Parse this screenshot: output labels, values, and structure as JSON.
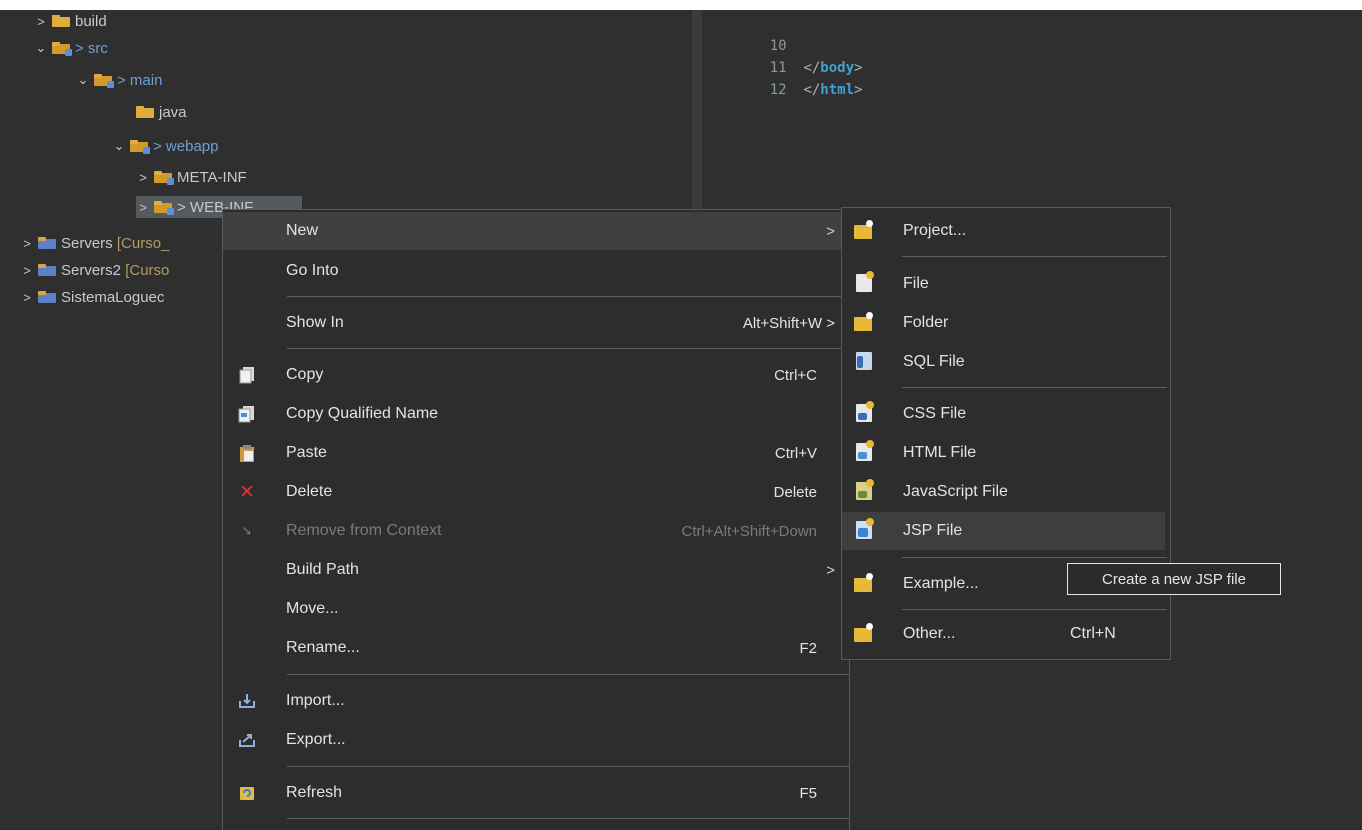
{
  "tree": {
    "items": [
      {
        "chevron": ">",
        "label": "build"
      },
      {
        "chevron": "⌄",
        "label": "> src"
      },
      {
        "chevron": "⌄",
        "label": "> main"
      },
      {
        "chevron": "",
        "label": "java"
      },
      {
        "chevron": "⌄",
        "label": "> webapp"
      },
      {
        "chevron": ">",
        "label": "META-INF"
      },
      {
        "chevron": ">",
        "label": "> WEB-INF"
      },
      {
        "chevron": ">",
        "label": "Servers",
        "suffix": "[Curso_"
      },
      {
        "chevron": ">",
        "label": "Servers2",
        "suffix": "[Curso"
      },
      {
        "chevron": ">",
        "label": "SistemaLoguec"
      }
    ]
  },
  "editor": {
    "lines": [
      {
        "num": "10",
        "open": "",
        "tag": "",
        "close": ""
      },
      {
        "num": "11",
        "open": "</",
        "tag": "body",
        "close": ">"
      },
      {
        "num": "12",
        "open": "</",
        "tag": "html",
        "close": ">"
      }
    ]
  },
  "context_menu": {
    "items": [
      {
        "label": "New",
        "shortcut": "",
        "arrow": ">"
      },
      {
        "label": "Go Into",
        "shortcut": ""
      },
      {
        "label": "Show In",
        "shortcut": "Alt+Shift+W >"
      },
      {
        "label": "Copy",
        "shortcut": "Ctrl+C",
        "icon": "copy-icon"
      },
      {
        "label": "Copy Qualified Name",
        "shortcut": "",
        "icon": "copy-qualified-name-icon"
      },
      {
        "label": "Paste",
        "shortcut": "Ctrl+V",
        "icon": "paste-icon"
      },
      {
        "label": "Delete",
        "shortcut": "Delete",
        "icon": "delete-icon"
      },
      {
        "label": "Remove from Context",
        "shortcut": "Ctrl+Alt+Shift+Down",
        "icon": "remove-context-icon"
      },
      {
        "label": "Build Path",
        "shortcut": "",
        "arrow": ">"
      },
      {
        "label": "Move...",
        "shortcut": ""
      },
      {
        "label": "Rename...",
        "shortcut": "F2"
      },
      {
        "label": "Import...",
        "shortcut": "",
        "icon": "import-icon"
      },
      {
        "label": "Export...",
        "shortcut": "",
        "icon": "export-icon"
      },
      {
        "label": "Refresh",
        "shortcut": "F5",
        "icon": "refresh-icon"
      }
    ]
  },
  "submenu_new": {
    "items": [
      {
        "label": "Project...",
        "shortcut": ""
      },
      {
        "label": "File",
        "shortcut": ""
      },
      {
        "label": "Folder",
        "shortcut": ""
      },
      {
        "label": "SQL File",
        "shortcut": ""
      },
      {
        "label": "CSS File",
        "shortcut": ""
      },
      {
        "label": "HTML File",
        "shortcut": ""
      },
      {
        "label": "JavaScript File",
        "shortcut": ""
      },
      {
        "label": "JSP File",
        "shortcut": ""
      },
      {
        "label": "Example...",
        "shortcut": ""
      },
      {
        "label": "Other...",
        "shortcut": "Ctrl+N"
      }
    ]
  },
  "tooltip": {
    "text": "Create a new JSP file"
  },
  "colors": {
    "background": "#2f2f2f",
    "menu_background": "#2d2d2d",
    "highlight": "#404040",
    "keyword_blue": "#3fa0d6",
    "folder_gold": "#e0ac3d",
    "delete_red": "#e03030"
  }
}
